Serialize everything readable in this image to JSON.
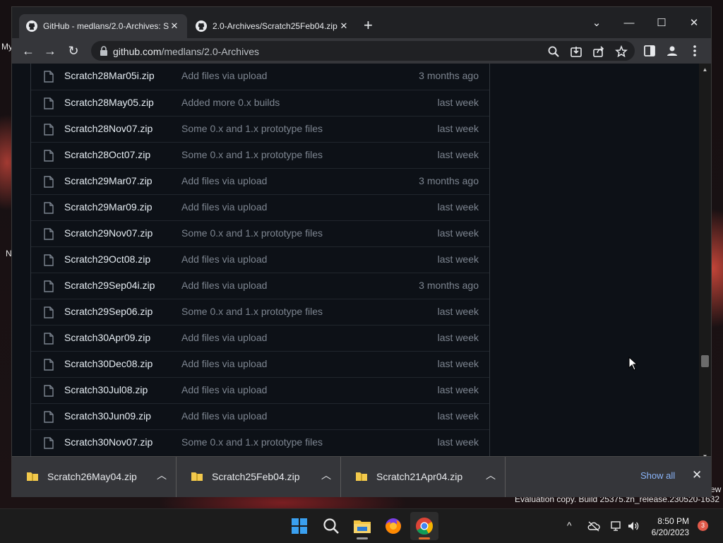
{
  "desktop": {
    "left_labels": [
      "My",
      "N"
    ],
    "right_label": "ew",
    "watermark": "Evaluation copy. Build 25375.zn_release.230520-1632"
  },
  "browser": {
    "tabs": [
      {
        "title": "GitHub - medlans/2.0-Archives: S",
        "active": true,
        "close": "✕"
      },
      {
        "title": "2.0-Archives/Scratch25Feb04.zip",
        "active": false,
        "close": "✕"
      }
    ],
    "new_tab": "+",
    "window_controls": {
      "tab_search": "⌄",
      "minimize": "—",
      "maximize": "☐",
      "close": "✕"
    },
    "nav": {
      "back": "←",
      "forward": "→",
      "reload": "↻"
    },
    "address": {
      "host": "github.com",
      "path": "/medlans/2.0-Archives"
    }
  },
  "files": [
    {
      "name": "Scratch28Mar05i.zip",
      "message": "Add files via upload",
      "age": "3 months ago"
    },
    {
      "name": "Scratch28May05.zip",
      "message": "Added more 0.x builds",
      "age": "last week"
    },
    {
      "name": "Scratch28Nov07.zip",
      "message": "Some 0.x and 1.x prototype files",
      "age": "last week"
    },
    {
      "name": "Scratch28Oct07.zip",
      "message": "Some 0.x and 1.x prototype files",
      "age": "last week"
    },
    {
      "name": "Scratch29Mar07.zip",
      "message": "Add files via upload",
      "age": "3 months ago"
    },
    {
      "name": "Scratch29Mar09.zip",
      "message": "Add files via upload",
      "age": "last week"
    },
    {
      "name": "Scratch29Nov07.zip",
      "message": "Some 0.x and 1.x prototype files",
      "age": "last week"
    },
    {
      "name": "Scratch29Oct08.zip",
      "message": "Add files via upload",
      "age": "last week"
    },
    {
      "name": "Scratch29Sep04i.zip",
      "message": "Add files via upload",
      "age": "3 months ago"
    },
    {
      "name": "Scratch29Sep06.zip",
      "message": "Some 0.x and 1.x prototype files",
      "age": "last week"
    },
    {
      "name": "Scratch30Apr09.zip",
      "message": "Add files via upload",
      "age": "last week"
    },
    {
      "name": "Scratch30Dec08.zip",
      "message": "Add files via upload",
      "age": "last week"
    },
    {
      "name": "Scratch30Jul08.zip",
      "message": "Add files via upload",
      "age": "last week"
    },
    {
      "name": "Scratch30Jun09.zip",
      "message": "Add files via upload",
      "age": "last week"
    },
    {
      "name": "Scratch30Nov07.zip",
      "message": "Some 0.x and 1.x prototype files",
      "age": "last week"
    }
  ],
  "downloads": {
    "items": [
      {
        "name": "Scratch26May04.zip"
      },
      {
        "name": "Scratch25Feb04.zip"
      },
      {
        "name": "Scratch21Apr04.zip"
      }
    ],
    "show_all": "Show all",
    "close": "✕"
  },
  "taskbar": {
    "time": "8:50 PM",
    "date": "6/20/2023",
    "notification_count": "3",
    "tray_chevron": "^"
  },
  "colors": {
    "github_bg": "#0d1117",
    "chrome_tab_active": "#35363a",
    "link_blue": "#8ab4f8",
    "muted_text": "#7d8590"
  }
}
